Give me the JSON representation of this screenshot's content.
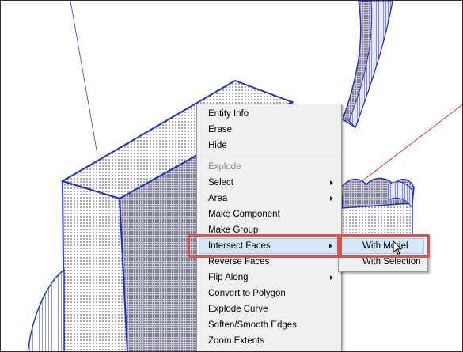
{
  "context_menu": {
    "items": [
      {
        "label": "Entity Info",
        "enabled": true,
        "submenu": false
      },
      {
        "label": "Erase",
        "enabled": true,
        "submenu": false
      },
      {
        "label": "Hide",
        "enabled": true,
        "submenu": false
      },
      {
        "label": "Explode",
        "enabled": false,
        "submenu": false
      },
      {
        "label": "Select",
        "enabled": true,
        "submenu": true
      },
      {
        "label": "Area",
        "enabled": true,
        "submenu": true
      },
      {
        "label": "Make Component",
        "enabled": true,
        "submenu": false
      },
      {
        "label": "Make Group",
        "enabled": true,
        "submenu": false
      },
      {
        "label": "Intersect Faces",
        "enabled": true,
        "submenu": true,
        "highlighted": true
      },
      {
        "label": "Reverse Faces",
        "enabled": true,
        "submenu": false
      },
      {
        "label": "Flip Along",
        "enabled": true,
        "submenu": true
      },
      {
        "label": "Convert to Polygon",
        "enabled": true,
        "submenu": false
      },
      {
        "label": "Explode Curve",
        "enabled": true,
        "submenu": false
      },
      {
        "label": "Soften/Smooth Edges",
        "enabled": true,
        "submenu": false
      },
      {
        "label": "Zoom Extents",
        "enabled": true,
        "submenu": false
      }
    ]
  },
  "submenu": {
    "items": [
      {
        "label": "With Model",
        "highlighted": true
      },
      {
        "label": "With Selection",
        "highlighted": false
      }
    ]
  },
  "colors": {
    "edge_blue": "#2233cc",
    "highlight_red": "#d9534f",
    "axis_red": "#cc2222",
    "menu_bg": "#f0f0f0",
    "selection_blue": "#d5e6f7"
  },
  "icons": [
    "mouse-cursor-icon",
    "submenu-arrow-icon"
  ]
}
